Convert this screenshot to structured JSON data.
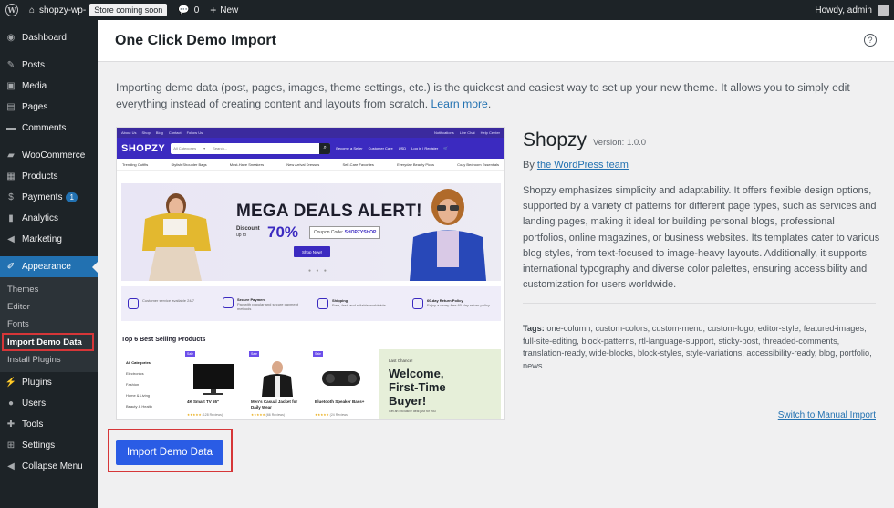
{
  "adminbar": {
    "site_name": "shopzy-wp-",
    "store_badge": "Store coming soon",
    "comments_count": "0",
    "new_label": "New",
    "howdy": "Howdy, admin"
  },
  "sidebar": {
    "items": [
      {
        "label": "Dashboard",
        "icon": "dashboard-icon"
      },
      {
        "label": "Posts",
        "icon": "pin-icon"
      },
      {
        "label": "Media",
        "icon": "media-icon"
      },
      {
        "label": "Pages",
        "icon": "page-icon"
      },
      {
        "label": "Comments",
        "icon": "comment-icon"
      },
      {
        "label": "WooCommerce",
        "icon": "woo-icon"
      },
      {
        "label": "Products",
        "icon": "archive-icon"
      },
      {
        "label": "Payments",
        "icon": "dollar-icon",
        "badge": "1"
      },
      {
        "label": "Analytics",
        "icon": "chart-icon"
      },
      {
        "label": "Marketing",
        "icon": "megaphone-icon"
      },
      {
        "label": "Appearance",
        "icon": "brush-icon"
      },
      {
        "label": "Plugins",
        "icon": "plugin-icon"
      },
      {
        "label": "Users",
        "icon": "user-icon"
      },
      {
        "label": "Tools",
        "icon": "wrench-icon"
      },
      {
        "label": "Settings",
        "icon": "settings-icon"
      },
      {
        "label": "Collapse Menu",
        "icon": "collapse-icon"
      }
    ],
    "appearance_sub": [
      "Themes",
      "Editor",
      "Fonts",
      "Import Demo Data",
      "Install Plugins"
    ]
  },
  "header": {
    "title": "One Click Demo Import"
  },
  "intro": {
    "text": "Importing demo data (post, pages, images, theme settings, etc.) is the quickest and easiest way to set up your new theme. It allows you to simply edit everything instead of creating content and layouts from scratch.",
    "link": "Learn more",
    "end": "."
  },
  "preview": {
    "top_links": [
      "About Us",
      "Shop",
      "Blog",
      "Contact",
      "Follow Us"
    ],
    "top_right": [
      "Notifications",
      "Live Chat",
      "Help Center"
    ],
    "logo": "SHOPZY",
    "category": "All Categories",
    "search": "Search...",
    "seller": "Become a Seller",
    "care": "Customer Care",
    "currency": "USD",
    "login": "Log in | Register",
    "nav": [
      "Trending Outfits",
      "Stylish Shoulder Bags",
      "Must-Have Sneakers",
      "New Arrival Dresses",
      "Self-Care Favorites",
      "Everyday Beauty Picks",
      "Cozy Bedroom Essentials"
    ],
    "hero_title": "MEGA DEALS ALERT!",
    "discount_label": "Discount",
    "upto": "up to",
    "percent": "70%",
    "coupon_label": "Coupon Code:",
    "coupon_code": "SHOPZYSHOP",
    "shop_now": "Shop Now!",
    "features": [
      {
        "title": "",
        "text": "Customer service available 24/7"
      },
      {
        "title": "Secure Payment",
        "text": "Pay with popular and secure payment methods"
      },
      {
        "title": "Shipping",
        "text": "Free, fast, and reliable worldwide"
      },
      {
        "title": "60-day Return Policy",
        "text": "Enjoy a worry-free 60-day return policy"
      }
    ],
    "best_title": "Top 6 Best Selling Products",
    "categories": [
      "All Categories",
      "Electronics",
      "Fashion",
      "Home & Living",
      "Beauty & Health"
    ],
    "products": [
      {
        "tag": "Sale",
        "name": "4K Smart TV 55\"",
        "reviews": "(128 Reviews)"
      },
      {
        "tag": "Sale",
        "name": "Men's Casual Jacket for Daily Wear",
        "reviews": "(66 Reviews)"
      },
      {
        "tag": "Sale",
        "name": "Bluetooth Speaker Bass+",
        "reviews": "(24 Reviews)"
      }
    ],
    "promo_small": "Last Chance!",
    "promo_title": "Welcome, First-Time Buyer!",
    "promo_text": "Get an exclusive deal just for you"
  },
  "theme": {
    "name": "Shopzy",
    "version": "Version: 1.0.0",
    "by": "By",
    "author": "the WordPress team",
    "description": "Shopzy emphasizes simplicity and adaptability. It offers flexible design options, supported by a variety of patterns for different page types, such as services and landing pages, making it ideal for building personal blogs, professional portfolios, online magazines, or business websites. Its templates cater to various blog styles, from text-focused to image-heavy layouts. Additionally, it supports international typography and diverse color palettes, ensuring accessibility and customization for users worldwide.",
    "tags_label": "Tags:",
    "tags": "one-column, custom-colors, custom-menu, custom-logo, editor-style, featured-images, full-site-editing, block-patterns, rtl-language-support, sticky-post, threaded-comments, translation-ready, wide-blocks, block-styles, style-variations, accessibility-ready, blog, portfolio, news"
  },
  "switch_link": "Switch to Manual Import",
  "import_button": "Import Demo Data",
  "colors": {
    "accent": "#2271b1",
    "button": "#2a5ce5",
    "highlight": "#d63638",
    "brand": "#3b2ac0"
  }
}
